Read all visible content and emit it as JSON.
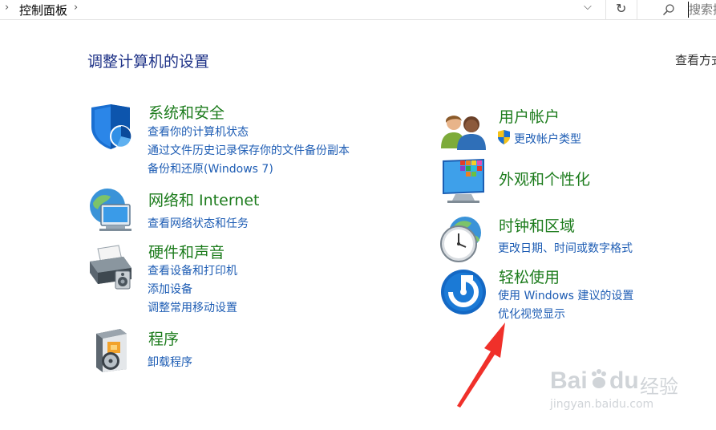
{
  "addressbar": {
    "breadcrumb": "控制面板",
    "search_placeholder": "搜索控制面板"
  },
  "header": {
    "title": "调整计算机的设置",
    "view_by": "查看方式"
  },
  "categories": [
    {
      "title": "系统和安全",
      "links": [
        "查看你的计算机状态",
        "通过文件历史记录保存你的文件备份副本",
        "备份和还原(Windows 7)"
      ],
      "icon": "shield-icon"
    },
    {
      "title": "网络和 Internet",
      "links": [
        "查看网络状态和任务"
      ],
      "icon": "network-globe-icon"
    },
    {
      "title": "硬件和声音",
      "links": [
        "查看设备和打印机",
        "添加设备",
        "调整常用移动设置"
      ],
      "icon": "printer-icon"
    },
    {
      "title": "程序",
      "links": [
        "卸载程序"
      ],
      "icon": "programs-icon"
    },
    {
      "title": "用户帐户",
      "links": [
        "更改帐户类型"
      ],
      "icon": "users-icon"
    },
    {
      "title": "外观和个性化",
      "links": [],
      "icon": "monitor-icon"
    },
    {
      "title": "时钟和区域",
      "links": [
        "更改日期、时间或数字格式"
      ],
      "icon": "clock-globe-icon"
    },
    {
      "title": "轻松使用",
      "links": [
        "使用 Windows 建议的设置",
        "优化视觉显示"
      ],
      "icon": "ease-of-access-icon"
    }
  ],
  "colors": {
    "title_blue": "#1e3287",
    "category_green": "#1d7c1d",
    "link_blue": "#1e5db4",
    "arrow_red": "#f0302a"
  },
  "watermark": {
    "brand": "Bai",
    "brand2": "du",
    "cn": "经验",
    "url": "jingyan.baidu.com"
  }
}
